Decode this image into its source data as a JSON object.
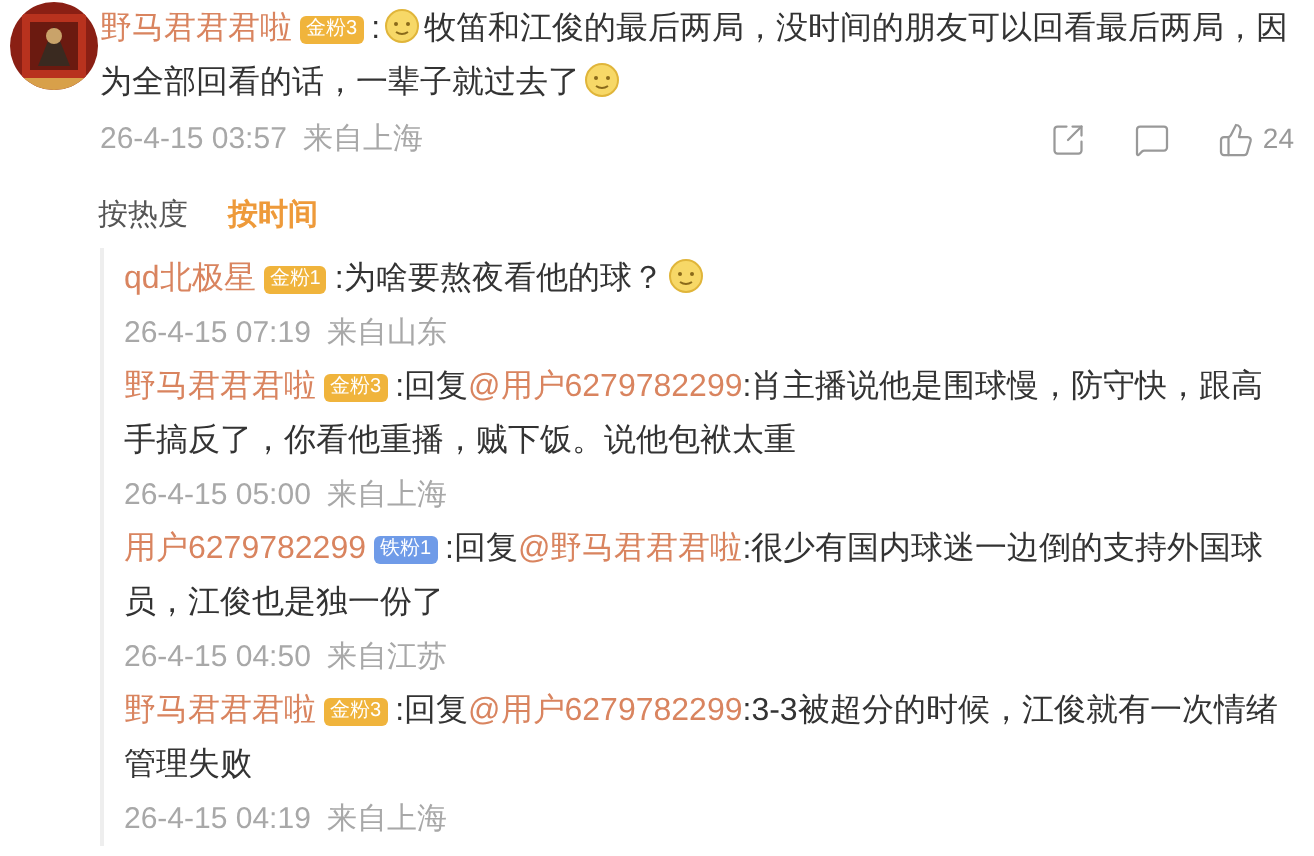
{
  "comment": {
    "name": "野马君君君啦",
    "badge": {
      "label": "金粉3",
      "color": "#f0b43c"
    },
    "segments": [
      {
        "kind": "text",
        "text": ":"
      },
      {
        "kind": "emoji"
      },
      {
        "kind": "text",
        "text": "牧笛和江俊的最后两局，没时间的朋友可以回看最后两局，因为全部回看的话，一辈子就过去了"
      },
      {
        "kind": "emoji"
      }
    ],
    "time": "26-4-15 03:57",
    "location": "来自上海",
    "like_count": "24"
  },
  "sort_tabs": [
    {
      "label": "按热度",
      "selected": false
    },
    {
      "label": "按时间",
      "selected": true
    }
  ],
  "replies": [
    {
      "name": "qd北极星",
      "badge": {
        "label": "金粉1",
        "color": "#f0b43c"
      },
      "segments": [
        {
          "kind": "text",
          "text": ":为啥要熬夜看他的球？"
        },
        {
          "kind": "emoji"
        }
      ],
      "time": "26-4-15 07:19",
      "location": "来自山东"
    },
    {
      "name": "野马君君君啦",
      "badge": {
        "label": "金粉3",
        "color": "#f0b43c"
      },
      "segments": [
        {
          "kind": "text",
          "text": ":回复"
        },
        {
          "kind": "mention",
          "text": "@用户6279782299"
        },
        {
          "kind": "text",
          "text": ":肖主播说他是围球慢，防守快，跟高手搞反了，你看他重播，贼下饭。说他包袱太重"
        }
      ],
      "time": "26-4-15 05:00",
      "location": "来自上海"
    },
    {
      "name": "用户6279782299",
      "badge": {
        "label": "铁粉1",
        "color": "#6f9be8"
      },
      "segments": [
        {
          "kind": "text",
          "text": ":回复"
        },
        {
          "kind": "mention",
          "text": "@野马君君君啦"
        },
        {
          "kind": "text",
          "text": ":很少有国内球迷一边倒的支持外国球员，江俊也是独一份了"
        }
      ],
      "time": "26-4-15 04:50",
      "location": "来自江苏"
    },
    {
      "name": "野马君君君啦",
      "badge": {
        "label": "金粉3",
        "color": "#f0b43c"
      },
      "segments": [
        {
          "kind": "text",
          "text": ":回复"
        },
        {
          "kind": "mention",
          "text": "@用户6279782299"
        },
        {
          "kind": "text",
          "text": ":3-3被超分的时候，江俊就有一次情绪管理失败"
        }
      ],
      "time": "26-4-15 04:19",
      "location": "来自上海"
    }
  ]
}
